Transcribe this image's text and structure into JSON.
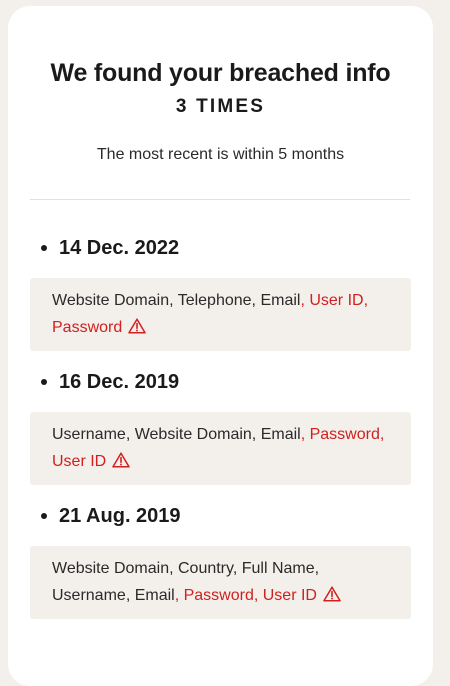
{
  "header": {
    "title": "We found your breached info",
    "count": "3 TIMES",
    "recent": "The most recent is within 5 months"
  },
  "breaches": [
    {
      "date": "14 Dec. 2022",
      "items": [
        {
          "label": "Website Domain",
          "sensitive": false
        },
        {
          "label": "Telephone",
          "sensitive": false
        },
        {
          "label": "Email",
          "sensitive": false
        },
        {
          "label": "User ID",
          "sensitive": true
        },
        {
          "label": "Password",
          "sensitive": true
        }
      ]
    },
    {
      "date": "16 Dec. 2019",
      "items": [
        {
          "label": "Username",
          "sensitive": false
        },
        {
          "label": "Website Domain",
          "sensitive": false
        },
        {
          "label": "Email",
          "sensitive": false
        },
        {
          "label": "Password",
          "sensitive": true
        },
        {
          "label": "User ID",
          "sensitive": true
        }
      ]
    },
    {
      "date": "21 Aug. 2019",
      "items": [
        {
          "label": "Website Domain",
          "sensitive": false
        },
        {
          "label": "Country",
          "sensitive": false
        },
        {
          "label": "Full Name",
          "sensitive": false
        },
        {
          "label": "Username",
          "sensitive": false
        },
        {
          "label": "Email",
          "sensitive": false
        },
        {
          "label": "Password",
          "sensitive": true
        },
        {
          "label": "User ID",
          "sensitive": true
        }
      ]
    }
  ],
  "icons": {
    "sensitive_warning": "warning-triangle-icon"
  },
  "colors": {
    "sensitive": "#d0201f",
    "box_background": "#f3f0ec",
    "text": "#1a1a1a"
  }
}
